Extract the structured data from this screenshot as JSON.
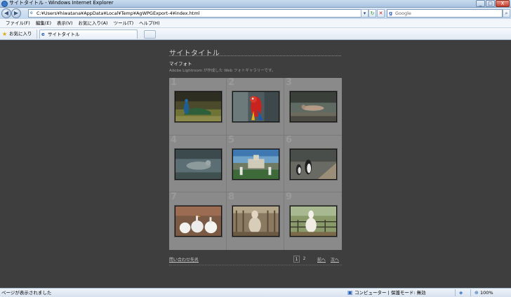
{
  "window": {
    "title": "サイトタイトル - Windows Internet Explorer",
    "controls": [
      "_",
      "□",
      "X"
    ]
  },
  "address_bar": {
    "url": "C:¥Users¥hiwatana¥AppData¥Local¥Temp¥AgWPGExport-4¥index.html",
    "search_placeholder": "Google"
  },
  "menu": {
    "items": [
      "ファイル(F)",
      "編集(E)",
      "表示(V)",
      "お気に入り(A)",
      "ツール(T)",
      "ヘルプ(H)"
    ]
  },
  "favorites_bar": {
    "favorites_label": "お気に入り",
    "tab_title": "サイトタイトル"
  },
  "gallery": {
    "site_title": "サイトタイトル",
    "collection_title": "マイフォト",
    "collection_description": "Adobe Lightroom が作成した Web フォトギャラリーです。",
    "thumbnails": [
      {
        "number": "1",
        "subject": "peacock"
      },
      {
        "number": "2",
        "subject": "macaw"
      },
      {
        "number": "3",
        "subject": "sea lion"
      },
      {
        "number": "4",
        "subject": "sea lion"
      },
      {
        "number": "5",
        "subject": "garden fountain"
      },
      {
        "number": "6",
        "subject": "penguins"
      },
      {
        "number": "7",
        "subject": "white geese"
      },
      {
        "number": "8",
        "subject": "alpaca"
      },
      {
        "number": "9",
        "subject": "alpaca"
      }
    ],
    "contact_link": "問い合わせ先名",
    "pages": [
      "1",
      "2"
    ],
    "current_page": "1",
    "prev_label": "前へ",
    "next_label": "次へ"
  },
  "status_bar": {
    "status_text": "ページが表示されました",
    "zone_text": "コンピューター | 保護モード: 無効",
    "zoom": "100%"
  }
}
